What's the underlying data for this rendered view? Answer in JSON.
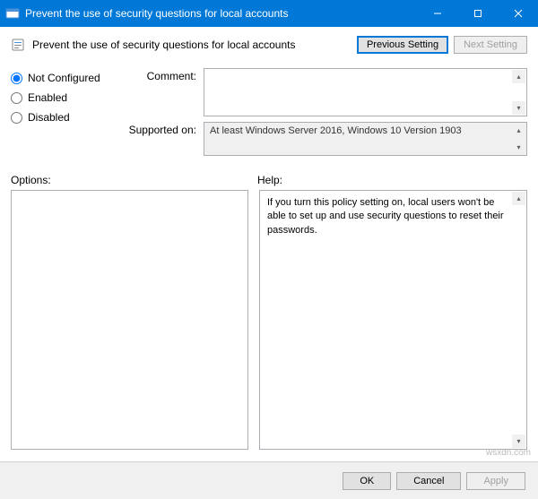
{
  "window": {
    "title": "Prevent the use of security questions for local accounts"
  },
  "policy": {
    "title": "Prevent the use of security questions for local accounts"
  },
  "nav": {
    "previous": "Previous Setting",
    "next": "Next Setting"
  },
  "state": {
    "not_configured": "Not Configured",
    "enabled": "Enabled",
    "disabled": "Disabled",
    "selected": "not_configured"
  },
  "fields": {
    "comment_label": "Comment:",
    "comment_value": "",
    "supported_label": "Supported on:",
    "supported_value": "At least Windows Server 2016, Windows 10 Version 1903"
  },
  "panels": {
    "options_label": "Options:",
    "help_label": "Help:",
    "help_text": "If you turn this policy setting on, local users won't be able to set up and use security questions to reset their passwords."
  },
  "buttons": {
    "ok": "OK",
    "cancel": "Cancel",
    "apply": "Apply"
  },
  "watermark": "wsxdn.com"
}
